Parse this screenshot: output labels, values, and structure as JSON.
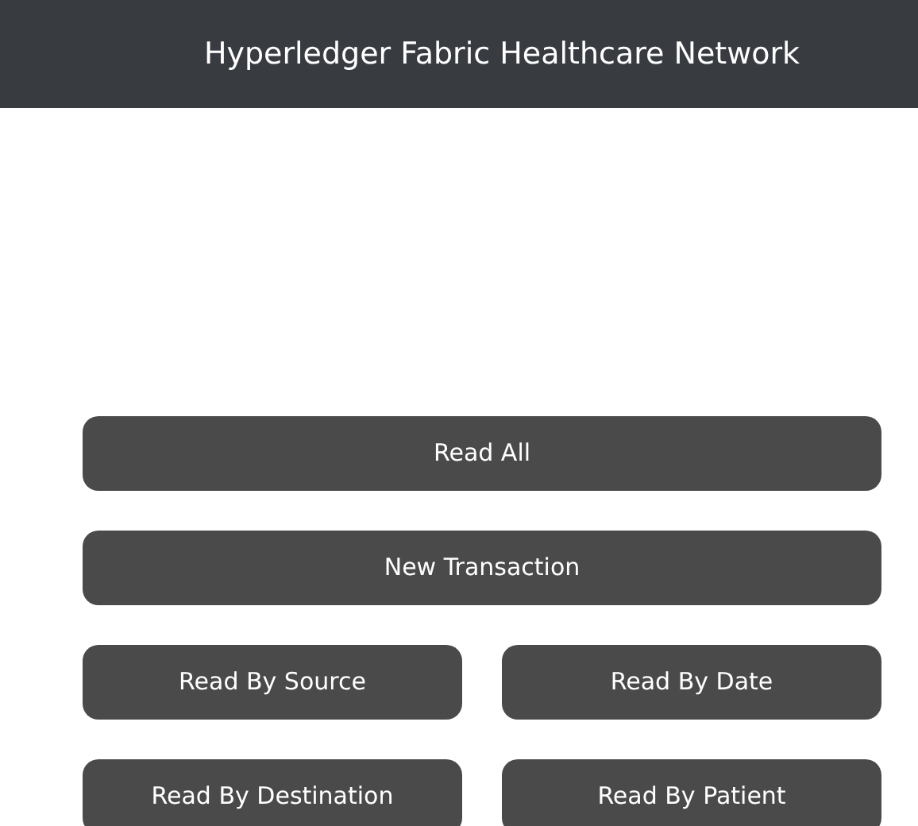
{
  "header": {
    "title": "Hyperledger Fabric Healthcare Network"
  },
  "buttons": [
    {
      "label": "Read All",
      "kind": "wide"
    },
    {
      "label": "New Transaction",
      "kind": "wide"
    },
    {
      "label": "Read By Source",
      "kind": "half"
    },
    {
      "label": "Read By Date",
      "kind": "half"
    },
    {
      "label": "Read By Destination",
      "kind": "half"
    },
    {
      "label": "Read By Patient",
      "kind": "half"
    }
  ]
}
